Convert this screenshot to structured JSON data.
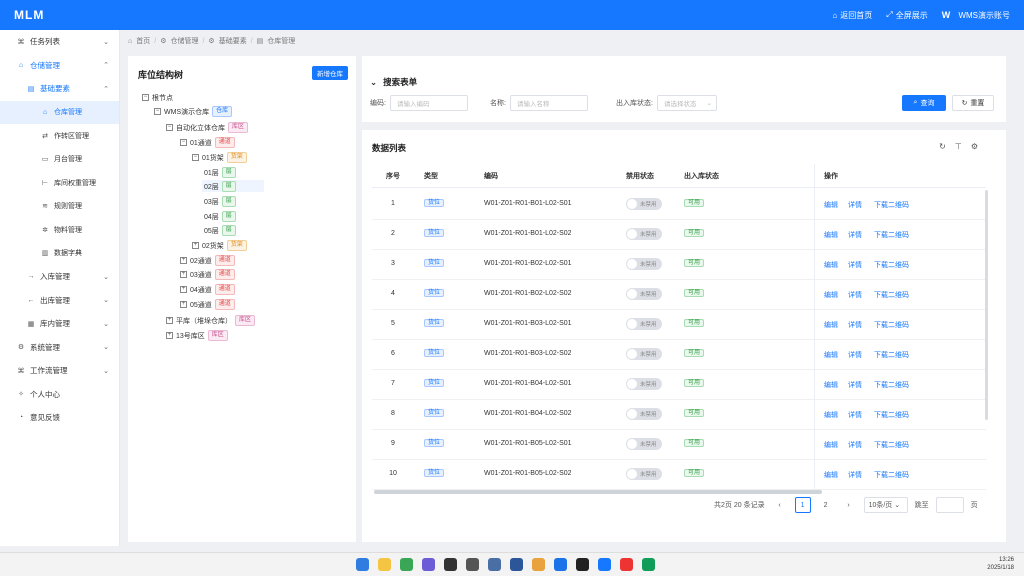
{
  "app": {
    "logo": "MLM"
  },
  "topbar": {
    "back_home": "返回首页",
    "fullscreen": "全屏展示",
    "brand_letter": "W",
    "account": "WMS演示账号"
  },
  "sidebar": {
    "items": [
      {
        "label": "任务列表",
        "icon": "⌘",
        "arrow": "⌄"
      },
      {
        "label": "仓储管理",
        "icon": "⌂",
        "arrow": "⌃"
      },
      {
        "label": "基础要素",
        "icon": "▤",
        "arrow": "⌃"
      },
      {
        "label": "仓库管理",
        "icon": "⌂"
      },
      {
        "label": "作转区管理",
        "icon": "⇄"
      },
      {
        "label": "月台管理",
        "icon": "▭"
      },
      {
        "label": "库间权重管理",
        "icon": "⊢"
      },
      {
        "label": "规则管理",
        "icon": "≋"
      },
      {
        "label": "物料管理",
        "icon": "✲"
      },
      {
        "label": "数据字典",
        "icon": "▥"
      },
      {
        "label": "入库管理",
        "icon": "→",
        "arrow": "⌄"
      },
      {
        "label": "出库管理",
        "icon": "←",
        "arrow": "⌄"
      },
      {
        "label": "库内管理",
        "icon": "▦",
        "arrow": "⌄"
      },
      {
        "label": "系统管理",
        "icon": "⚙",
        "arrow": "⌄"
      },
      {
        "label": "工作流管理",
        "icon": "⌘",
        "arrow": "⌄"
      },
      {
        "label": "个人中心",
        "icon": "✧"
      },
      {
        "label": "意见反馈",
        "icon": "◔"
      }
    ]
  },
  "breadcrumb": {
    "items": [
      "首页",
      "仓储管理",
      "基础要素",
      "仓库管理"
    ]
  },
  "tree": {
    "title": "库位结构树",
    "add_button": "新增仓库",
    "nodes": {
      "root": "根节点",
      "wh": "WMS演示仓库",
      "wh_tag": "仓库",
      "zone1": "自动化立体仓库",
      "zone1_tag": "库区",
      "lane1": "01通道",
      "lane1_tag": "通道",
      "shelf1": "01货架",
      "shelf1_tag": "货架",
      "layers": [
        "01层",
        "02层",
        "03层",
        "04层",
        "05层"
      ],
      "layer_tag": "层",
      "shelf2": "02货架",
      "shelf2_tag": "货架",
      "lanes": [
        "02通道",
        "03通道",
        "04通道",
        "05通道"
      ],
      "lane_tag": "通道",
      "zone2": "平库（堆垛仓库）",
      "zone2_tag": "库区",
      "zone3": "13号库区",
      "zone3_tag": "库区"
    }
  },
  "search": {
    "title": "搜索表单",
    "code_label": "编码:",
    "code_placeholder": "请输入编码",
    "name_label": "名称:",
    "name_placeholder": "请输入名称",
    "status_label": "出入库状态:",
    "status_placeholder": "请选择状态",
    "query_button": "查询",
    "reset_button": "重置"
  },
  "table": {
    "title": "数据列表",
    "columns": [
      "序号",
      "类型",
      "编码",
      "禁用状态",
      "出入库状态",
      "操作"
    ],
    "type_tag": "货位",
    "switch_text": "未禁用",
    "status_tag": "可用",
    "ops": [
      "编辑",
      "详情",
      "下载二维码"
    ],
    "rows": [
      {
        "no": "1",
        "code": "W01-Z01-R01-B01-L02-S01"
      },
      {
        "no": "2",
        "code": "W01-Z01-R01-B01-L02-S02"
      },
      {
        "no": "3",
        "code": "W01-Z01-R01-B02-L02-S01"
      },
      {
        "no": "4",
        "code": "W01-Z01-R01-B02-L02-S02"
      },
      {
        "no": "5",
        "code": "W01-Z01-R01-B03-L02-S01"
      },
      {
        "no": "6",
        "code": "W01-Z01-R01-B03-L02-S02"
      },
      {
        "no": "7",
        "code": "W01-Z01-R01-B04-L02-S01"
      },
      {
        "no": "8",
        "code": "W01-Z01-R01-B04-L02-S02"
      },
      {
        "no": "9",
        "code": "W01-Z01-R01-B05-L02-S01"
      },
      {
        "no": "10",
        "code": "W01-Z01-R01-B05-L02-S02"
      }
    ]
  },
  "pagination": {
    "summary": "共2页 20 条记录",
    "prev": "‹",
    "pages": [
      "1",
      "2"
    ],
    "next": "›",
    "page_size": "10条/页",
    "jump_label": "跳至",
    "page_unit": "页"
  },
  "taskbar": {
    "time": "13:26",
    "date": "2025/1/18"
  },
  "colors": {
    "primary": "#1677ff"
  }
}
